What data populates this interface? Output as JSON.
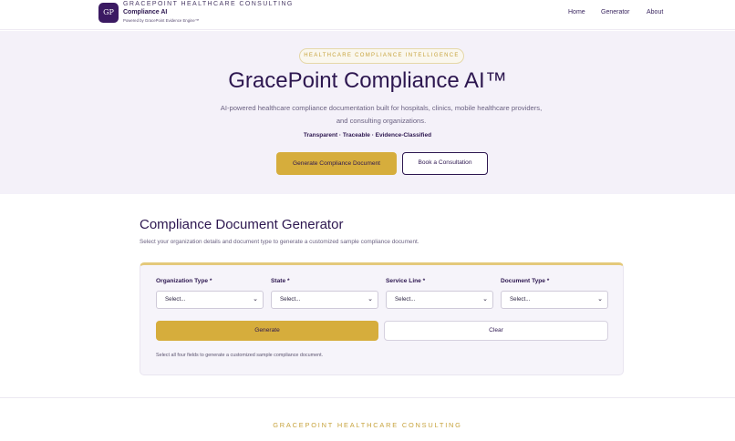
{
  "header": {
    "logo_text": "GP",
    "brand_top": "GRACEPOINT HEALTHCARE CONSULTING",
    "brand_name": "Compliance AI",
    "brand_sub": "Powered by GracePoint Evidence Engine™",
    "nav": [
      "Home",
      "Generator",
      "About"
    ]
  },
  "hero": {
    "pill": "HEALTHCARE COMPLIANCE INTELLIGENCE",
    "title": "GracePoint Compliance AI™",
    "description": "AI-powered healthcare compliance documentation built for hospitals, clinics, mobile healthcare providers, and consulting organizations.",
    "tagline": "Transparent · Traceable · Evidence-Classified",
    "primary_button": "Generate Compliance Document",
    "secondary_button": "Book a Consultation"
  },
  "generator": {
    "title": "Compliance Document Generator",
    "subtitle": "Select your organization details and document type to generate a customized sample compliance document.",
    "fields": [
      {
        "label": "Organization Type *",
        "value": "Select..."
      },
      {
        "label": "State *",
        "value": "Select..."
      },
      {
        "label": "Service Line *",
        "value": "Select..."
      },
      {
        "label": "Document Type *",
        "value": "Select..."
      }
    ],
    "generate_button": "Generate",
    "clear_button": "Clear",
    "hint": "Select all four fields to generate a customized sample compliance document."
  },
  "footer": {
    "brand": "GRACEPOINT HEALTHCARE CONSULTING"
  },
  "colors": {
    "brand_purple": "#2d1750",
    "gold": "#d6ad3c",
    "hero_bg": "#f4f1f9"
  }
}
